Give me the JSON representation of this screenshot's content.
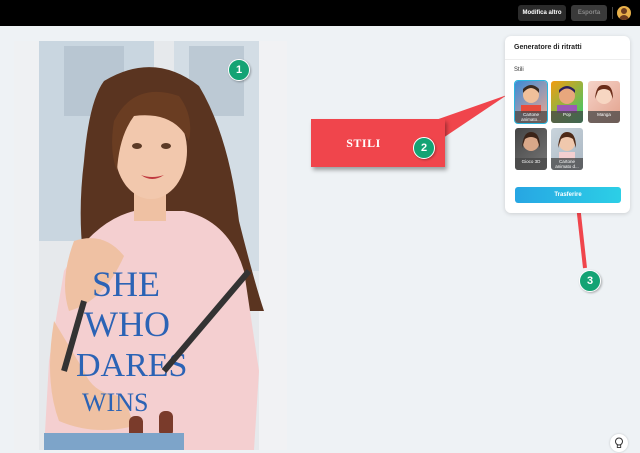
{
  "topbar": {
    "modify_label": "Modifica altro",
    "export_label": "Esporta"
  },
  "panel": {
    "title": "Generatore di ritratti",
    "styles_label": "Stili",
    "styles": [
      {
        "label": "Cartone animato..."
      },
      {
        "label": "Pop"
      },
      {
        "label": "Manga"
      },
      {
        "label": "Gioco 3D"
      },
      {
        "label": "Cartone animato d..."
      }
    ],
    "transfer_label": "Trasferire"
  },
  "photo": {
    "shirt_text": [
      "SHE",
      "WHO",
      "DARES",
      "WINS"
    ]
  },
  "annotations": {
    "callout_text": "STILI",
    "badge1": "1",
    "badge2": "2",
    "badge3": "3"
  }
}
